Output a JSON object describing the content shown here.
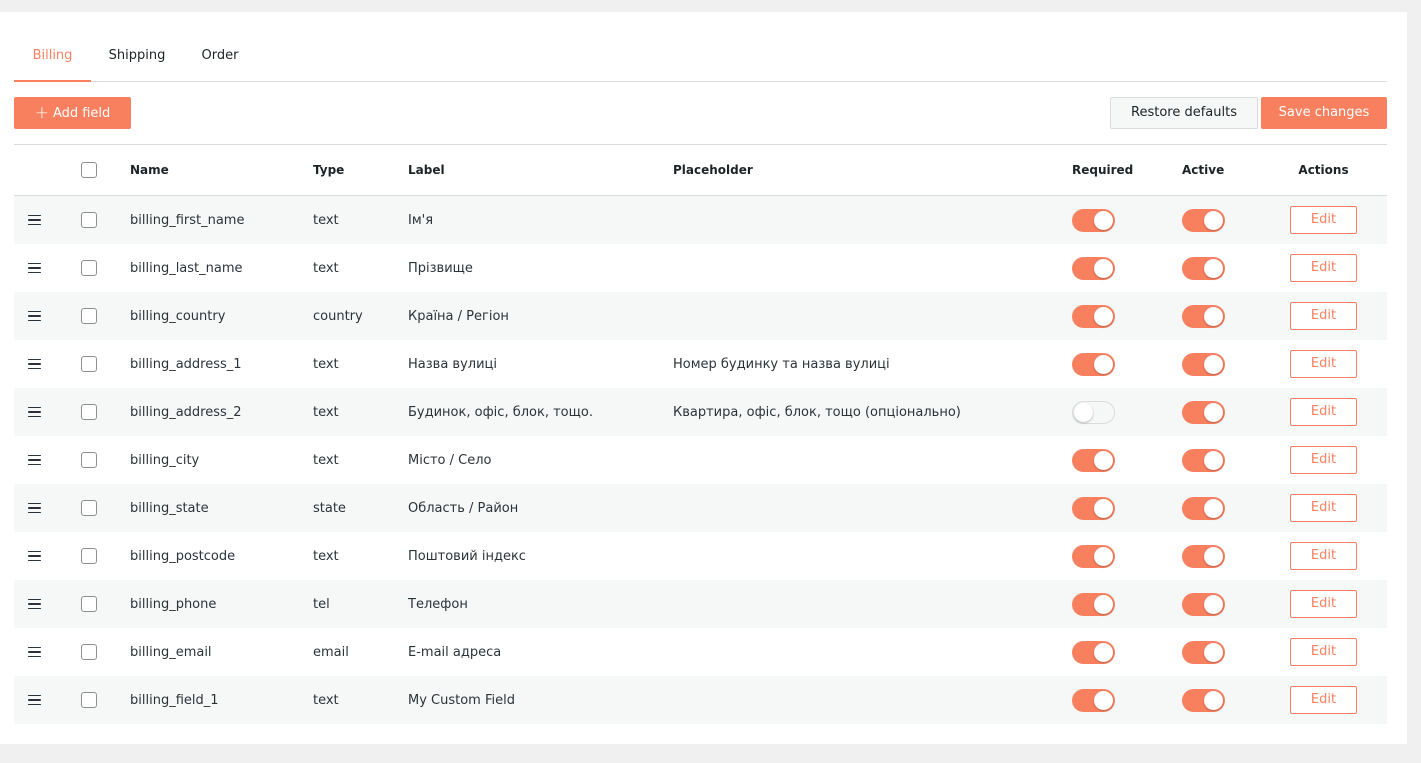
{
  "tabs": [
    {
      "label": "Billing",
      "active": true
    },
    {
      "label": "Shipping",
      "active": false
    },
    {
      "label": "Order",
      "active": false
    }
  ],
  "toolbar": {
    "add_label": "Add field",
    "restore_label": "Restore defaults",
    "save_label": "Save changes"
  },
  "table": {
    "headers": {
      "name": "Name",
      "type": "Type",
      "label": "Label",
      "placeholder": "Placeholder",
      "required": "Required",
      "active": "Active",
      "actions": "Actions"
    },
    "edit_label": "Edit",
    "rows": [
      {
        "name": "billing_first_name",
        "type": "text",
        "label": "Ім'я",
        "placeholder": "",
        "required": true,
        "active": true
      },
      {
        "name": "billing_last_name",
        "type": "text",
        "label": "Прізвище",
        "placeholder": "",
        "required": true,
        "active": true
      },
      {
        "name": "billing_country",
        "type": "country",
        "label": "Країна / Регіон",
        "placeholder": "",
        "required": true,
        "active": true
      },
      {
        "name": "billing_address_1",
        "type": "text",
        "label": "Назва вулиці",
        "placeholder": "Номер будинку та назва вулиці",
        "required": true,
        "active": true
      },
      {
        "name": "billing_address_2",
        "type": "text",
        "label": "Будинок, офіс, блок, тощо.",
        "placeholder": "Квартира, офіс, блок, тощо (опціонально)",
        "required": false,
        "active": true
      },
      {
        "name": "billing_city",
        "type": "text",
        "label": "Місто / Село",
        "placeholder": "",
        "required": true,
        "active": true
      },
      {
        "name": "billing_state",
        "type": "state",
        "label": "Область / Район",
        "placeholder": "",
        "required": true,
        "active": true
      },
      {
        "name": "billing_postcode",
        "type": "text",
        "label": "Поштовий індекс",
        "placeholder": "",
        "required": true,
        "active": true
      },
      {
        "name": "billing_phone",
        "type": "tel",
        "label": "Телефон",
        "placeholder": "",
        "required": true,
        "active": true
      },
      {
        "name": "billing_email",
        "type": "email",
        "label": "E-mail адреса",
        "placeholder": "",
        "required": true,
        "active": true
      },
      {
        "name": "billing_field_1",
        "type": "text",
        "label": "My Custom Field",
        "placeholder": "",
        "required": true,
        "active": true
      }
    ]
  },
  "colors": {
    "accent": "#f9805f",
    "stripe": "#f6f7f7",
    "border": "#dcdcde"
  }
}
